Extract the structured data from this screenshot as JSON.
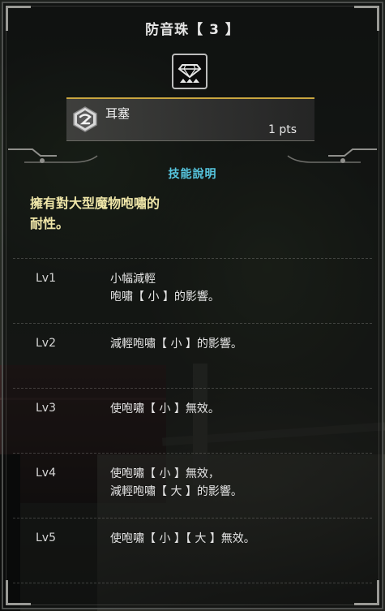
{
  "title": "防音珠【 3 】",
  "decoration_icon": "diamond-gem-icon",
  "skill": {
    "name": "耳塞",
    "points": "1 pts",
    "icon": "earplug-skill-icon"
  },
  "section_header": "技能說明",
  "description": "擁有對大型魔物咆嘯的\n耐性。",
  "levels": [
    {
      "level": "Lv1",
      "effect": "小幅減輕\n咆嘯【 小 】的影響。"
    },
    {
      "level": "Lv2",
      "effect": "減輕咆嘯【 小 】的影響。"
    },
    {
      "level": "Lv3",
      "effect": "使咆嘯【 小 】無效。"
    },
    {
      "level": "Lv4",
      "effect": "使咆嘯【 小 】無效，\n減輕咆嘯【 大 】的影響。"
    },
    {
      "level": "Lv5",
      "effect": "使咆嘯【 小 】【 大 】無效。"
    }
  ],
  "colors": {
    "section_header": "#57c7e0",
    "description": "#efe6a8",
    "accent_gold": "#c9a640"
  }
}
